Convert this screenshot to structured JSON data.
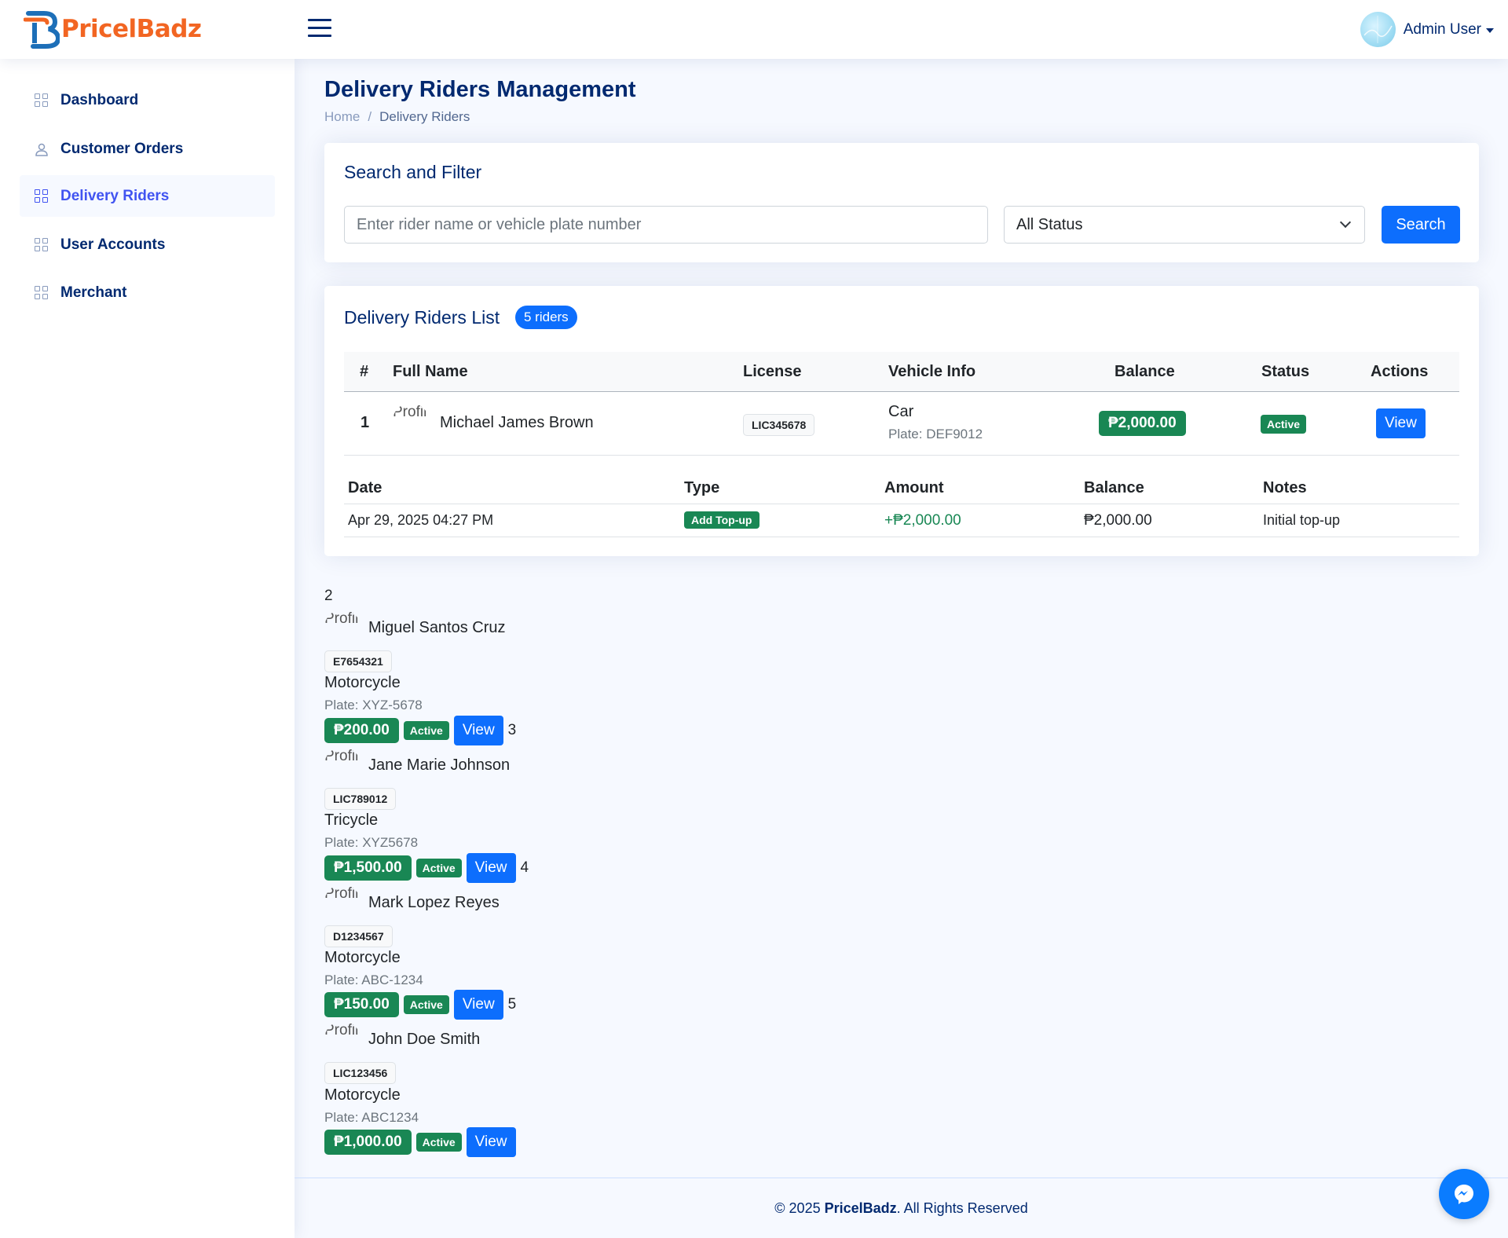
{
  "brand": {
    "name": "PricelBadz"
  },
  "header": {
    "user_name": "Admin User"
  },
  "sidebar": {
    "items": [
      {
        "label": "Dashboard",
        "icon": "grid-icon"
      },
      {
        "label": "Customer Orders",
        "icon": "person-icon"
      },
      {
        "label": "Delivery Riders",
        "icon": "grid-icon",
        "active": true
      },
      {
        "label": "User Accounts",
        "icon": "grid-icon"
      },
      {
        "label": "Merchant",
        "icon": "grid-icon"
      }
    ]
  },
  "page": {
    "title": "Delivery Riders Management",
    "breadcrumb": [
      "Home",
      "Delivery Riders"
    ]
  },
  "filter": {
    "title": "Search and Filter",
    "search_placeholder": "Enter rider name or vehicle plate number",
    "status_selected": "All Status",
    "search_button": "Search"
  },
  "list": {
    "title": "Delivery Riders List",
    "count_badge": "5 riders",
    "columns": [
      "#",
      "Full Name",
      "License",
      "Vehicle Info",
      "Balance",
      "Status",
      "Actions"
    ],
    "image_alt": "Profile",
    "plate_prefix": "Plate: ",
    "view_label": "View",
    "riders": [
      {
        "num": "1",
        "name": "Michael James Brown",
        "license": "LIC345678",
        "vehicle": "Car",
        "plate": "DEF9012",
        "balance": "₱2,000.00",
        "status": "Active"
      },
      {
        "num": "2",
        "name": "Miguel Santos Cruz",
        "license": "E7654321",
        "vehicle": "Motorcycle",
        "plate": "XYZ-5678",
        "balance": "₱200.00",
        "status": "Active"
      },
      {
        "num": "3",
        "name": "Jane Marie Johnson",
        "license": "LIC789012",
        "vehicle": "Tricycle",
        "plate": "XYZ5678",
        "balance": "₱1,500.00",
        "status": "Active"
      },
      {
        "num": "4",
        "name": "Mark Lopez Reyes",
        "license": "D1234567",
        "vehicle": "Motorcycle",
        "plate": "ABC-1234",
        "balance": "₱150.00",
        "status": "Active"
      },
      {
        "num": "5",
        "name": "John Doe Smith",
        "license": "LIC123456",
        "vehicle": "Motorcycle",
        "plate": "ABC1234",
        "balance": "₱1,000.00",
        "status": "Active"
      }
    ],
    "transactions": {
      "columns": [
        "Date",
        "Type",
        "Amount",
        "Balance",
        "Notes"
      ],
      "rows": [
        {
          "date": "Apr 29, 2025 04:27 PM",
          "type": "Add Top-up",
          "amount": "+₱2,000.00",
          "balance": "₱2,000.00",
          "notes": "Initial top-up"
        }
      ]
    }
  },
  "footer": {
    "prefix": "© 2025 ",
    "brand": "PricelBadz",
    "suffix": ". All Rights Reserved"
  },
  "colors": {
    "primary": "#0d6efd",
    "success": "#198754",
    "navy": "#012970",
    "brand_orange": "#f26522",
    "brand_blue": "#1d6fb8"
  }
}
